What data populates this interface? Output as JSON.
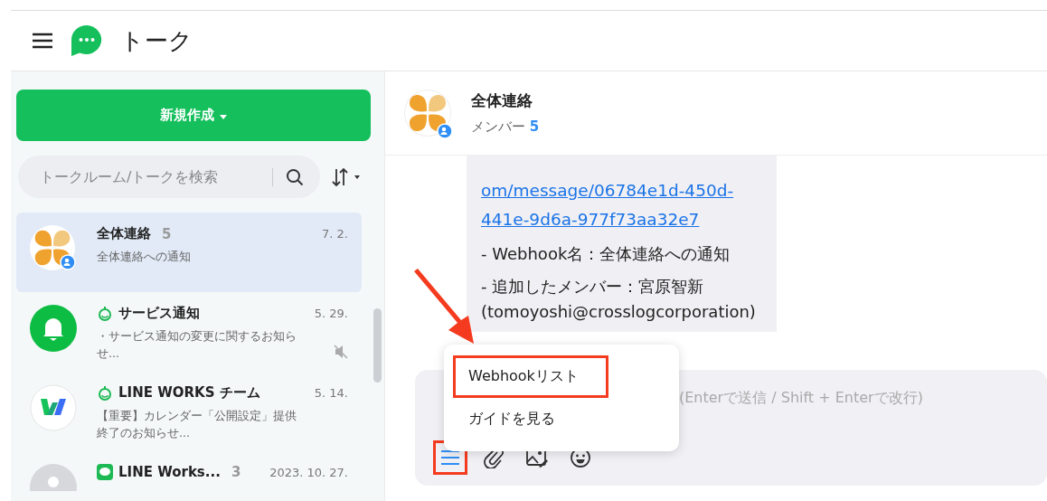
{
  "header": {
    "title": "トーク"
  },
  "sidebar": {
    "new_button": "新規作成",
    "search": {
      "placeholder": "トークルーム/トークを検索"
    },
    "rooms": [
      {
        "name": "全体連絡",
        "count": "5",
        "preview": "全体連絡への通知",
        "date": "7. 2.",
        "selected": true,
        "avatar": {
          "kind": "clover"
        },
        "muted": false
      },
      {
        "name": "サービス通知",
        "preview": "・サービス通知の変更に関するお知らせ...",
        "date": "5. 29.",
        "selected": false,
        "avatar": {
          "kind": "bell"
        },
        "badge": {
          "kind": "bot"
        },
        "muted": true
      },
      {
        "name": "LINE WORKS チーム",
        "preview": "【重要】カレンダー「公開設定」提供終了のお知らせ...",
        "date": "5. 14.",
        "selected": false,
        "avatar": {
          "kind": "w"
        },
        "badge": {
          "kind": "bot"
        },
        "muted": false
      },
      {
        "name": "LINE Works...",
        "count": "3",
        "date": "2023. 10. 27.",
        "selected": false,
        "avatar": {
          "kind": "gray"
        },
        "badge": {
          "kind": "line"
        },
        "muted": false
      }
    ]
  },
  "chat": {
    "title": "全体連絡",
    "members_label": "メンバー",
    "member_count": "5",
    "message": {
      "link": "om/message/06784e1d-450d-441e-9d6a-977f73aa32e7",
      "lines": [
        "- Webhook名：全体連絡への通知",
        "- 追加したメンバー：宮原智新 (tomoyoshi@crosslogcorporation)"
      ]
    },
    "composer": {
      "placeholder": "(Enterで送信 / Shift + Enterで改行)",
      "menu": [
        {
          "label": "Webhookリスト",
          "highlighted": true
        },
        {
          "label": "ガイドを見る",
          "highlighted": false
        }
      ],
      "tools": [
        {
          "kind": "menu",
          "highlighted": true
        },
        {
          "kind": "clip",
          "highlighted": false
        },
        {
          "kind": "image",
          "highlighted": false
        },
        {
          "kind": "emoji",
          "highlighted": false
        }
      ]
    }
  }
}
